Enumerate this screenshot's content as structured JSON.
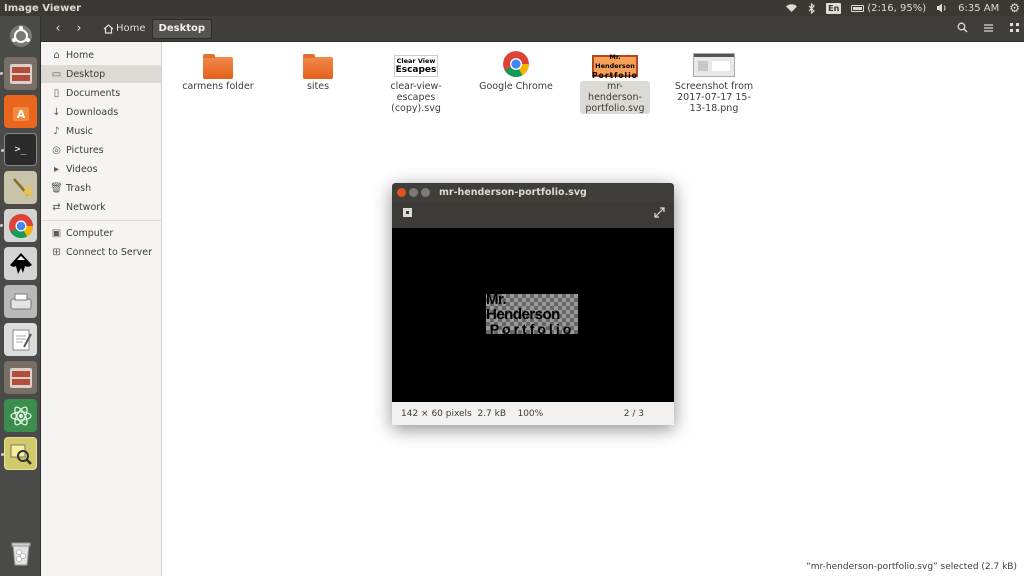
{
  "topbar": {
    "app_title": "Image Viewer",
    "keyboard_layout": "En",
    "battery": "(2:16, 95%)",
    "clock": "6:35 AM"
  },
  "launcher": {
    "items": [
      {
        "name": "ubuntu-dash",
        "color": "#6a6a68"
      },
      {
        "name": "files",
        "color": "#b64a3d"
      },
      {
        "name": "software-center",
        "color": "#e8661d"
      },
      {
        "name": "terminal",
        "color": "#2b2b2b"
      },
      {
        "name": "system-cleaner",
        "color": "#e0d9b5"
      },
      {
        "name": "google-chrome",
        "color": "#dedede"
      },
      {
        "name": "inkscape",
        "color": "#dedede"
      },
      {
        "name": "scanner",
        "color": "#c9c9c9"
      },
      {
        "name": "text-editor",
        "color": "#e8e8e8"
      },
      {
        "name": "files-2",
        "color": "#b64a3d"
      },
      {
        "name": "atom",
        "color": "#3b8c4d"
      },
      {
        "name": "image-viewer",
        "color": "#d2c96b"
      },
      {
        "name": "trash",
        "color": "#cfcfcf"
      }
    ]
  },
  "header": {
    "breadcrumb_home": "Home",
    "breadcrumb_current": "Desktop"
  },
  "sidebar": {
    "items": [
      {
        "label": "Home",
        "icon": "home-icon"
      },
      {
        "label": "Desktop",
        "icon": "desktop-icon",
        "selected": true
      },
      {
        "label": "Documents",
        "icon": "document-icon"
      },
      {
        "label": "Downloads",
        "icon": "download-icon"
      },
      {
        "label": "Music",
        "icon": "music-icon"
      },
      {
        "label": "Pictures",
        "icon": "camera-icon"
      },
      {
        "label": "Videos",
        "icon": "video-icon"
      },
      {
        "label": "Trash",
        "icon": "trash-icon"
      },
      {
        "label": "Network",
        "icon": "network-icon"
      },
      {
        "label": "Computer",
        "icon": "computer-icon"
      },
      {
        "label": "Connect to Server",
        "icon": "server-icon"
      }
    ]
  },
  "files": [
    {
      "label": "carmens folder",
      "type": "folder"
    },
    {
      "label": "sites",
      "type": "folder"
    },
    {
      "label": "clear-view-escapes (copy).svg",
      "type": "svg-clear-view",
      "thumb_line1": "Clear View",
      "thumb_line2": "Escapes"
    },
    {
      "label": "Google Chrome",
      "type": "chrome"
    },
    {
      "label": "mr-henderson-portfolio.svg",
      "type": "svg-henderson",
      "selected": true,
      "thumb_line1": "Mr. Henderson",
      "thumb_line2": "Portfolio"
    },
    {
      "label": "Screenshot from 2017-07-17 15-13-18.png",
      "type": "screenshot"
    }
  ],
  "status_bar": "“mr-henderson-portfolio.svg” selected  (2.7 kB)",
  "viewer": {
    "title": "mr-henderson-portfolio.svg",
    "image_line1": "Mr. Henderson",
    "image_line2": "Portfolio",
    "info": "142 × 60 pixels  2.7 kB    100%",
    "index": "2 / 3"
  }
}
